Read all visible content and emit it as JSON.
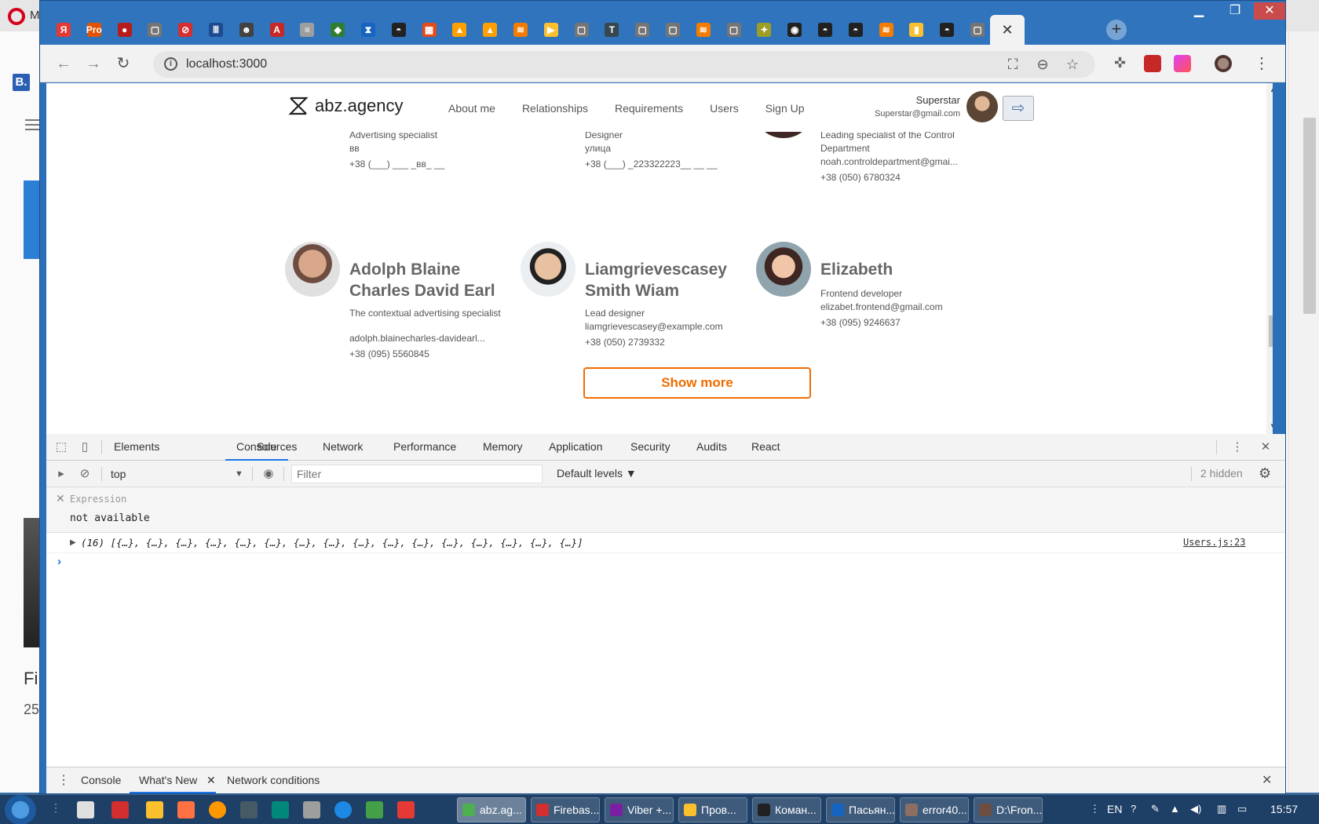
{
  "background_app": {
    "tab_prefix": "M",
    "side_text_1": "Fi",
    "side_text_2": "25",
    "bookmark_letter": "B."
  },
  "window": {
    "min": "▁",
    "max": "❐",
    "close": "✕"
  },
  "browser": {
    "url": "localhost:3000",
    "tabs": [
      {
        "icon": "yandex-icon",
        "glyph": "Я",
        "color": "#e53935"
      },
      {
        "icon": "pro-icon",
        "glyph": "Pro",
        "color": "#e65100"
      },
      {
        "icon": "record-icon",
        "glyph": "●",
        "color": "#b71c1c"
      },
      {
        "icon": "page-icon",
        "glyph": "▢",
        "color": "#757575"
      },
      {
        "icon": "opera-red-icon",
        "glyph": "⊘",
        "color": "#d32f2f"
      },
      {
        "icon": "bars-icon",
        "glyph": "Ⅲ",
        "color": "#1e4b8f"
      },
      {
        "icon": "octocat-face-icon",
        "glyph": "☻",
        "color": "#424242"
      },
      {
        "icon": "angular-icon",
        "glyph": "A",
        "color": "#c62828"
      },
      {
        "icon": "stack-icon",
        "glyph": "≡",
        "color": "#9e9e9e"
      },
      {
        "icon": "evernote-icon",
        "glyph": "◆",
        "color": "#2e7d32"
      },
      {
        "icon": "hourglass-icon",
        "glyph": "⧗",
        "color": "#1565c0"
      },
      {
        "icon": "glasses-icon",
        "glyph": "◓",
        "color": "#212121"
      },
      {
        "icon": "hacker-icon",
        "glyph": "▦",
        "color": "#e64a19"
      },
      {
        "icon": "firebase-icon",
        "glyph": "▲",
        "color": "#ffa000"
      },
      {
        "icon": "firebase-icon",
        "glyph": "▲",
        "color": "#ffa000"
      },
      {
        "icon": "stackoverflow-icon",
        "glyph": "≋",
        "color": "#f57c00"
      },
      {
        "icon": "play-icon",
        "glyph": "▶",
        "color": "#fbc02d"
      },
      {
        "icon": "page-icon",
        "glyph": "▢",
        "color": "#757575"
      },
      {
        "icon": "t-icon",
        "glyph": "T",
        "color": "#37474f"
      },
      {
        "icon": "page-icon",
        "glyph": "▢",
        "color": "#757575"
      },
      {
        "icon": "page-icon",
        "glyph": "▢",
        "color": "#757575"
      },
      {
        "icon": "stackoverflow-icon",
        "glyph": "≋",
        "color": "#f57c00"
      },
      {
        "icon": "page-icon",
        "glyph": "▢",
        "color": "#757575"
      },
      {
        "icon": "lightbulb-icon",
        "glyph": "✦",
        "color": "#9e9d24"
      },
      {
        "icon": "github-icon",
        "glyph": "◉",
        "color": "#212121"
      },
      {
        "icon": "glasses-icon",
        "glyph": "◓",
        "color": "#212121"
      },
      {
        "icon": "glasses-icon",
        "glyph": "◓",
        "color": "#212121"
      },
      {
        "icon": "stackoverflow-icon",
        "glyph": "≋",
        "color": "#f57c00"
      },
      {
        "icon": "folder-yellow-icon",
        "glyph": "▮",
        "color": "#fbc02d"
      },
      {
        "icon": "glasses-icon",
        "glyph": "◓",
        "color": "#212121"
      },
      {
        "icon": "page-icon",
        "glyph": "▢",
        "color": "#757575"
      }
    ],
    "active_tab_close": "✕",
    "new_tab": "+"
  },
  "site": {
    "logo": "abz.agency",
    "nav": [
      "About me",
      "Relationships",
      "Requirements",
      "Users",
      "Sign Up"
    ],
    "user": {
      "name": "Superstar",
      "email": "Superstar@gmail.com"
    },
    "logout_icon": "⇨",
    "top_cards": [
      {
        "lines": [
          "Advertising specialist",
          "вв",
          "+38 (___) ___ _вв_ __"
        ]
      },
      {
        "lines": [
          "Designer",
          "улица",
          "+38 (___) _223322223__ __ __"
        ]
      },
      {
        "lines": [
          "Leading specialist of the Control Department",
          "noah.controldepartment@gmai...",
          "+38 (050) 6780324"
        ]
      }
    ],
    "cards": [
      {
        "name": "Adolph Blaine Charles David Earl",
        "position": "The contextual advertising specialist",
        "email": "adolph.blainecharles-davidearl...",
        "phone": "+38 (095) 5560845"
      },
      {
        "name": "Liamgrievescasey Smith Wiam",
        "position": "Lead designer",
        "email": "liamgrievescasey@example.com",
        "phone": "+38 (050) 2739332"
      },
      {
        "name": "Elizabeth",
        "position": "Frontend developer",
        "email": "elizabet.frontend@gmail.com",
        "phone": "+38 (095) 9246637"
      }
    ],
    "show_more": "Show more"
  },
  "devtools": {
    "tabs": [
      "Elements",
      "Console",
      "Sources",
      "Network",
      "Performance",
      "Memory",
      "Application",
      "Security",
      "Audits",
      "React"
    ],
    "active_tab": "Console",
    "context": "top",
    "filter_placeholder": "Filter",
    "levels": "Default levels ▼",
    "hidden": "2 hidden",
    "expression_label": "Expression",
    "expression_value": "not available",
    "log_text": "(16) [{…}, {…}, {…}, {…}, {…}, {…}, {…}, {…}, {…}, {…}, {…}, {…}, {…}, {…}, {…}, {…}]",
    "log_source": "Users.js:23",
    "drawer_tabs": [
      "Console",
      "What's New",
      "Network conditions"
    ]
  },
  "taskbar": {
    "tasks": [
      {
        "label": "abz.ag...",
        "color": "#4caf50",
        "active": true
      },
      {
        "label": "Firebas...",
        "color": "#d32f2f"
      },
      {
        "label": "Viber +...",
        "color": "#7b1fa2"
      },
      {
        "label": "Пров...",
        "color": "#fbc02d"
      },
      {
        "label": "Коман...",
        "color": "#212121"
      },
      {
        "label": "Пасьян...",
        "color": "#1565c0"
      },
      {
        "label": "error40...",
        "color": "#8d6e63"
      },
      {
        "label": "D:\\Fron...",
        "color": "#6d4c41"
      }
    ],
    "lang": "EN",
    "time": "15:57"
  }
}
